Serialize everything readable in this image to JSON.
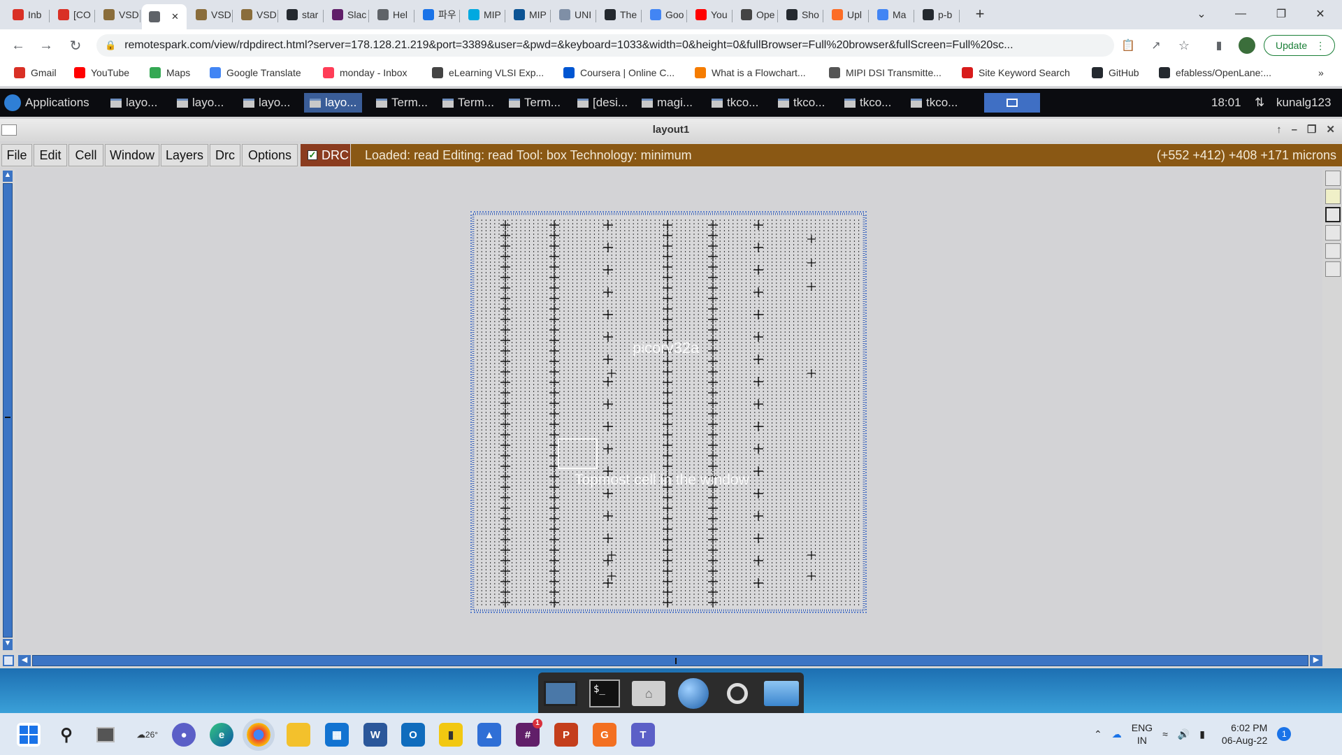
{
  "browser": {
    "tabs": [
      {
        "label": "Inb",
        "icon": "gmail-icon",
        "color": "#d93025"
      },
      {
        "label": "[CO",
        "icon": "gmail-icon",
        "color": "#d93025"
      },
      {
        "label": "VSD",
        "icon": "vsd-icon",
        "color": "#8a6d3b"
      },
      {
        "label": "",
        "icon": "globe-icon",
        "color": "#5f6368",
        "active": true
      },
      {
        "label": "VSD",
        "icon": "vsd-icon",
        "color": "#8a6d3b"
      },
      {
        "label": "VSD",
        "icon": "vsd-icon",
        "color": "#8a6d3b"
      },
      {
        "label": "star",
        "icon": "github-icon",
        "color": "#24292f"
      },
      {
        "label": "Slac",
        "icon": "slack-icon",
        "color": "#611f69"
      },
      {
        "label": "Hel",
        "icon": "globe-icon",
        "color": "#5f6368"
      },
      {
        "label": "파우",
        "icon": "app-icon",
        "color": "#1a73e8"
      },
      {
        "label": "MIP",
        "icon": "c-icon",
        "color": "#00a9e0"
      },
      {
        "label": "MIP",
        "icon": "doc-icon",
        "color": "#0b5394"
      },
      {
        "label": "UNI",
        "icon": "uni-icon",
        "color": "#7f8fa6"
      },
      {
        "label": "The",
        "icon": "github-icon",
        "color": "#24292f"
      },
      {
        "label": "Goo",
        "icon": "translate-icon",
        "color": "#4285f4"
      },
      {
        "label": "You",
        "icon": "youtube-icon",
        "color": "#ff0000"
      },
      {
        "label": "Ope",
        "icon": "book-icon",
        "color": "#444444"
      },
      {
        "label": "Sho",
        "icon": "github-icon",
        "color": "#24292f"
      },
      {
        "label": "Upl",
        "icon": "gitlab-icon",
        "color": "#fc6d26"
      },
      {
        "label": "Ma",
        "icon": "g-icon",
        "color": "#4285f4"
      },
      {
        "label": "p-b",
        "icon": "github-icon",
        "color": "#24292f"
      }
    ],
    "new_tab": "+",
    "url": "remotespark.com/view/rdpdirect.html?server=178.128.21.219&port=3389&user=&pwd=&keyboard=1033&width=0&height=0&fullBrowser=Full%20browser&fullScreen=Full%20sc...",
    "update_label": "Update",
    "bookmarks": [
      {
        "label": "Gmail",
        "icon": "gmail-icon",
        "color": "#d93025"
      },
      {
        "label": "YouTube",
        "icon": "youtube-icon",
        "color": "#ff0000"
      },
      {
        "label": "Maps",
        "icon": "maps-icon",
        "color": "#34a853"
      },
      {
        "label": "Google Translate",
        "icon": "translate-icon",
        "color": "#4285f4"
      },
      {
        "label": "monday - Inbox",
        "icon": "monday-icon",
        "color": "#ff3d57"
      },
      {
        "label": "eLearning VLSI Exp...",
        "icon": "elearning-icon",
        "color": "#444444"
      },
      {
        "label": "Coursera | Online C...",
        "icon": "coursera-icon",
        "color": "#0056d2"
      },
      {
        "label": "What is a Flowchart...",
        "icon": "lucid-icon",
        "color": "#f57c00"
      },
      {
        "label": "MIPI DSI Transmitte...",
        "icon": "mipi-icon",
        "color": "#555555"
      },
      {
        "label": "Site Keyword Search",
        "icon": "seo-icon",
        "color": "#d81b1b"
      },
      {
        "label": "GitHub",
        "icon": "github-icon",
        "color": "#24292f"
      },
      {
        "label": "efabless/OpenLane:...",
        "icon": "github-icon",
        "color": "#24292f"
      }
    ],
    "bookmarks_more": "»"
  },
  "panel": {
    "applications_label": "Applications",
    "tasks": [
      "layo...",
      "layo...",
      "layo...",
      "layo...",
      "Term...",
      "Term...",
      "Term...",
      "[desi...",
      "magi...",
      "tkco...",
      "tkco...",
      "tkco...",
      "tkco..."
    ],
    "selected_task": 3,
    "clock": "18:01",
    "user": "kunalg123"
  },
  "magic": {
    "window_title": "layout1",
    "menu": [
      "File",
      "Edit",
      "Cell",
      "Window",
      "Layers",
      "Drc",
      "Options"
    ],
    "drc_label": "DRC",
    "drc_checked": true,
    "status": "Loaded: read Editing: read Tool: box  Technology: minimum",
    "coordinates": "(+552 +412) +408 +171 microns",
    "cell_name": "picorv32a",
    "topmost_label": "Topmost cell in the window"
  },
  "taskbar": {
    "weather": "26°",
    "language": "ENG",
    "region": "IN",
    "time": "6:02 PM",
    "date": "06-Aug-22",
    "notification_count": "1",
    "outlook_badge": "1"
  },
  "colors": {
    "status_bar": "#8a5814",
    "drc_button": "#8b3c1f",
    "scrollbar": "#3b74c4",
    "panel_selected": "#3a5d98"
  }
}
